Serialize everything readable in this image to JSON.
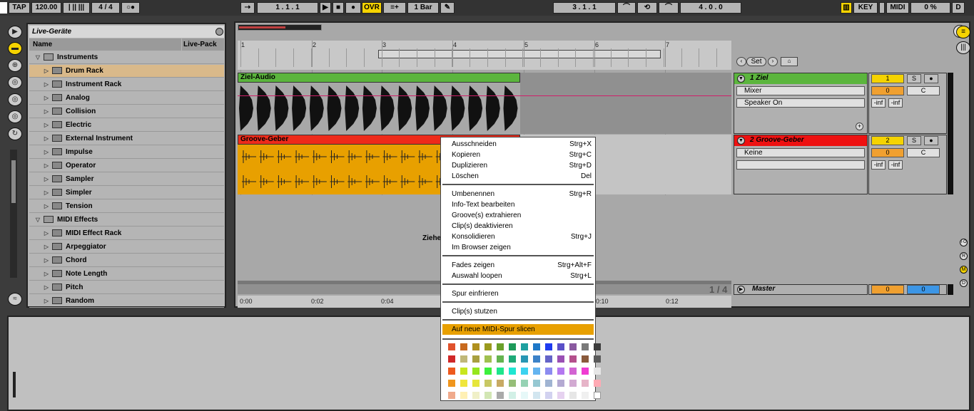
{
  "transport": {
    "tap": "TAP",
    "tempo": "120.00",
    "meter": "4 / 4",
    "pos": "1 .  1 .  1",
    "ovr": "OVR",
    "quant": "1 Bar",
    "loop_start": "3 .  1 .  1",
    "loop_len": "4 .  0 .  0",
    "key": "KEY",
    "midi": "MIDI",
    "cpu": "0 %",
    "d": "D"
  },
  "browser": {
    "title": "Live-Geräte",
    "col_name": "Name",
    "col_pack": "Live-Pack",
    "items": [
      {
        "label": "Instruments",
        "type": "folder-open"
      },
      {
        "label": "Drum Rack",
        "type": "device",
        "selected": true
      },
      {
        "label": "Instrument Rack",
        "type": "device"
      },
      {
        "label": "Analog",
        "type": "device"
      },
      {
        "label": "Collision",
        "type": "device"
      },
      {
        "label": "Electric",
        "type": "device"
      },
      {
        "label": "External Instrument",
        "type": "device"
      },
      {
        "label": "Impulse",
        "type": "device"
      },
      {
        "label": "Operator",
        "type": "device"
      },
      {
        "label": "Sampler",
        "type": "device"
      },
      {
        "label": "Simpler",
        "type": "device"
      },
      {
        "label": "Tension",
        "type": "device"
      },
      {
        "label": "MIDI Effects",
        "type": "folder-open"
      },
      {
        "label": "MIDI Effect Rack",
        "type": "device"
      },
      {
        "label": "Arpeggiator",
        "type": "device"
      },
      {
        "label": "Chord",
        "type": "device"
      },
      {
        "label": "Note Length",
        "type": "device"
      },
      {
        "label": "Pitch",
        "type": "device"
      },
      {
        "label": "Random",
        "type": "device"
      }
    ]
  },
  "arrangement": {
    "bars": [
      "1",
      "2",
      "3",
      "4",
      "5",
      "6",
      "7"
    ],
    "times": [
      "0:00",
      "0:02",
      "0:04",
      "0:10",
      "0:12"
    ],
    "set_label": "Set",
    "page": "1 / 4",
    "drop_hint": "Ziehe",
    "clip1": "Ziel-Audio",
    "clip2": "Groove-Geber"
  },
  "tracks": [
    {
      "name": "1 Ziel",
      "color": "#5aaa3c",
      "num": "1",
      "solo": "S",
      "routing1": "Mixer",
      "routing2": "Speaker On",
      "vol": "0",
      "pan": "C",
      "inf1": "-inf",
      "inf2": "-inf"
    },
    {
      "name": "2 Groove-Geber",
      "color": "#ee1111",
      "num": "2",
      "solo": "S",
      "routing1": "Keine",
      "routing2": "",
      "vol": "0",
      "pan": "C",
      "inf1": "-inf",
      "inf2": "-inf"
    }
  ],
  "master": {
    "name": "Master",
    "vol": "0",
    "vol2": "0"
  },
  "menu": {
    "groups": [
      [
        {
          "label": "Ausschneiden",
          "shortcut": "Strg+X"
        },
        {
          "label": "Kopieren",
          "shortcut": "Strg+C"
        },
        {
          "label": "Duplizieren",
          "shortcut": "Strg+D"
        },
        {
          "label": "Löschen",
          "shortcut": "Del"
        }
      ],
      [
        {
          "label": "Umbenennen",
          "shortcut": "Strg+R"
        },
        {
          "label": "Info-Text bearbeiten",
          "shortcut": ""
        },
        {
          "label": "Groove(s) extrahieren",
          "shortcut": ""
        },
        {
          "label": "Clip(s) deaktivieren",
          "shortcut": ""
        },
        {
          "label": "Konsolidieren",
          "shortcut": "Strg+J"
        },
        {
          "label": "Im Browser zeigen",
          "shortcut": ""
        }
      ],
      [
        {
          "label": "Fades zeigen",
          "shortcut": "Strg+Alt+F"
        },
        {
          "label": "Auswahl loopen",
          "shortcut": "Strg+L"
        }
      ],
      [
        {
          "label": "Spur einfrieren",
          "shortcut": ""
        }
      ],
      [
        {
          "label": "Clip(s) stutzen",
          "shortcut": ""
        }
      ],
      [
        {
          "label": "Auf neue MIDI-Spur slicen",
          "shortcut": "",
          "highlight": true
        }
      ]
    ],
    "swatches": [
      [
        "#e0522c",
        "#c86a1e",
        "#b0901e",
        "#9a9a1e",
        "#6aa02a",
        "#1e9a5a",
        "#1ea0a0",
        "#1e78c8",
        "#1e3cf0",
        "#5a50c8",
        "#8a5aa0",
        "#7a7a7a",
        "#3c3c3c"
      ],
      [
        "#d02828",
        "#c0b878",
        "#a8a040",
        "#a0c050",
        "#64b450",
        "#1eaa78",
        "#2896b4",
        "#3c82c8",
        "#6464c8",
        "#9a50b4",
        "#b4508c",
        "#8a5a3c",
        "#5a5a5a"
      ],
      [
        "#ee5a1e",
        "#c8e61e",
        "#96e61e",
        "#3cf03c",
        "#1ee68c",
        "#1ee6d2",
        "#3cd2f0",
        "#64b4f0",
        "#8c8cf0",
        "#b478f0",
        "#d264d2",
        "#f03cd2",
        "#e6e6e6"
      ],
      [
        "#f0961e",
        "#f0e63c",
        "#e6e63c",
        "#c8c864",
        "#c8aa64",
        "#96be78",
        "#96d2b4",
        "#96c8d2",
        "#a0b4d2",
        "#b4aad2",
        "#d2aad2",
        "#e6b4c8",
        "#ffaab4"
      ],
      [
        "#f0aa8c",
        "#fff0b4",
        "#f0f0c8",
        "#d2e6b4",
        "#aaaaaa",
        "#d2f0e6",
        "#e6f8f8",
        "#d2e6f0",
        "#d2d2f0",
        "#e6d2f0",
        "#e6e6e6",
        "#f0f0f0",
        "#ffffff"
      ]
    ]
  }
}
